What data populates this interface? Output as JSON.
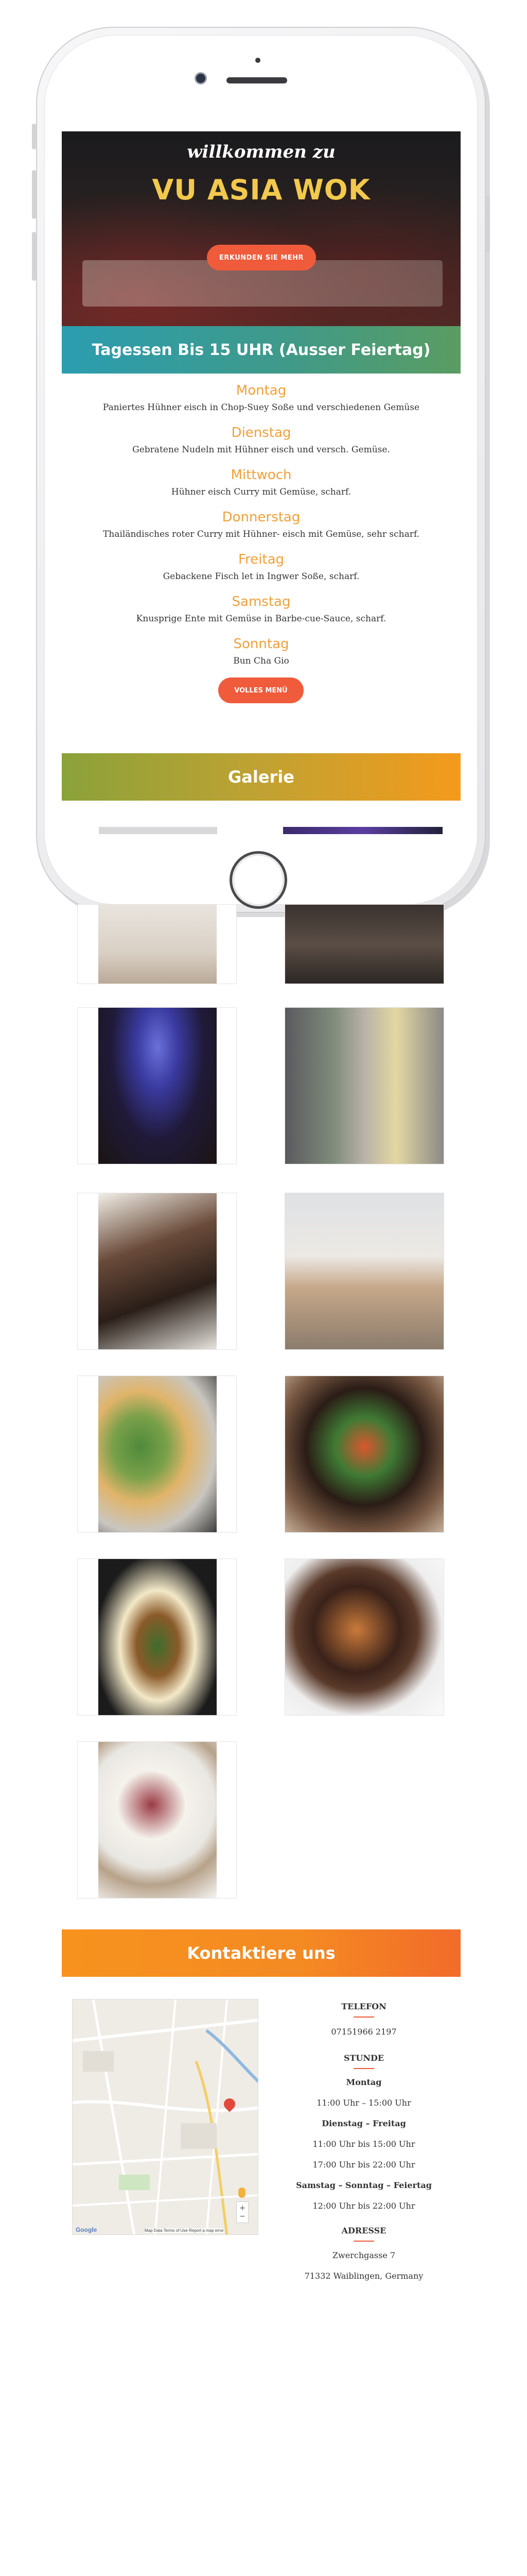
{
  "hero": {
    "welcome": "willkommen zu",
    "title": "VU ASIA WOK",
    "button": "ERKUNDEN SIE MEHR"
  },
  "lunch": {
    "heading": "Tagessen Bis 15 UHR (Ausser Feiertag)",
    "days": [
      {
        "day": "Montag",
        "dish": "Paniertes Hühner eisch in Chop-Suey Soße und verschiedenen Gemüse"
      },
      {
        "day": "Dienstag",
        "dish": "Gebratene Nudeln mit Hühner eisch und versch. Gemüse."
      },
      {
        "day": "Mittwoch",
        "dish": "Hühner eisch Curry mit Gemüse, scharf."
      },
      {
        "day": "Donnerstag",
        "dish": "Thailändisches roter Curry mit Hühner- eisch mit Gemüse, sehr scharf."
      },
      {
        "day": "Freitag",
        "dish": "Gebackene Fisch let in Ingwer Soße, scharf."
      },
      {
        "day": "Samstag",
        "dish": "Knusprige Ente mit Gemüse in Barbe-cue-Sauce, scharf."
      },
      {
        "day": "Sonntag",
        "dish": "Bun Cha Gio"
      }
    ],
    "button": "VOLLES MENÜ"
  },
  "gallery": {
    "heading": "Galerie"
  },
  "contact": {
    "heading": "Kontaktiere uns",
    "phone_label": "TELEFON",
    "phone": "07151966 2197",
    "hours_label": "STUNDE",
    "hours": [
      {
        "label": "Montag",
        "times": [
          "11:00 Uhr – 15:00 Uhr"
        ]
      },
      {
        "label": "Dienstag – Freitag",
        "times": [
          "11:00 Uhr bis 15:00 Uhr",
          "17:00 Uhr bis 22:00 Uhr"
        ]
      },
      {
        "label": "Samstag – Sonntag – Feiertag",
        "times": [
          "12:00 Uhr bis 22:00 Uhr"
        ]
      }
    ],
    "address_label": "ADRESSE",
    "street": "Zwerchgasse 7",
    "city": "71332 Waiblingen, Germany"
  },
  "map": {
    "attribution": "Map Data   Terms of Use   Report a map error",
    "logo": "Google",
    "zoom_in": "+",
    "zoom_out": "−"
  },
  "colors": {
    "accent": "#ef5b3b",
    "day": "#f0a03a",
    "hero_title": "#f2c94c"
  }
}
